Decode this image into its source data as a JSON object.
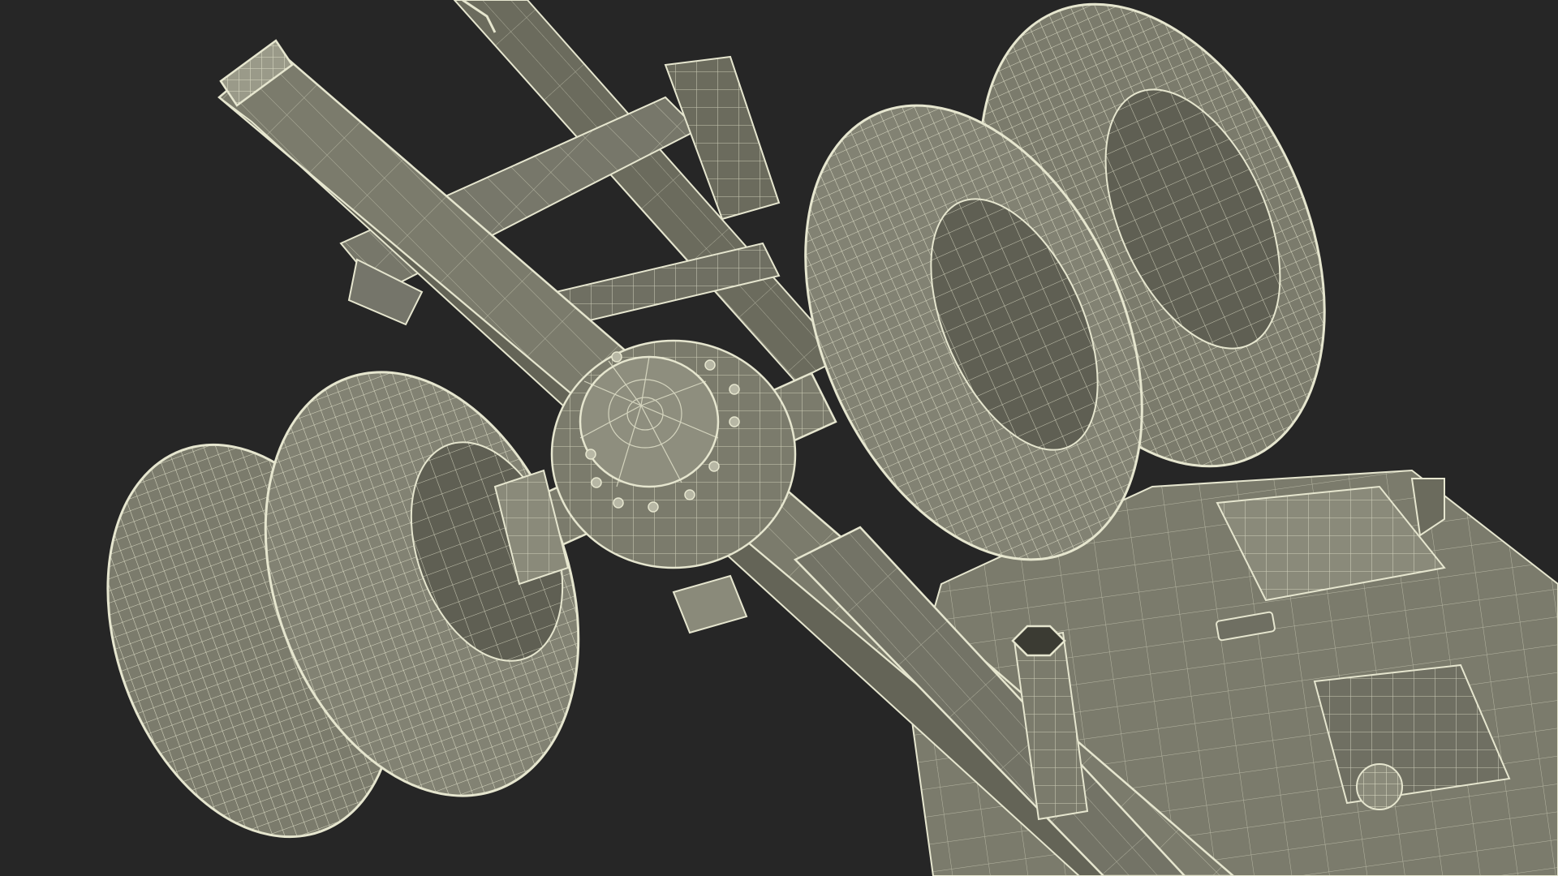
{
  "scene": {
    "subject": "wireframe-render",
    "colors": {
      "background": "#262626",
      "surface": "#7b7b6c",
      "surface_dark": "#5f5f53",
      "surface_light": "#9a9a89",
      "wire": "#e6e6cf",
      "shadow": "#3e3e36"
    },
    "parts": {
      "tires": 4,
      "frame_rails": 2,
      "differential_bolts": 10
    }
  }
}
